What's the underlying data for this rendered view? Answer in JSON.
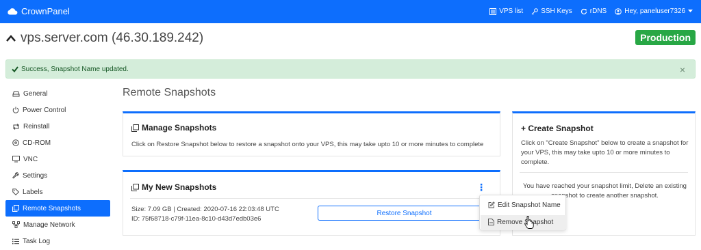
{
  "brand": {
    "name": "CrownPanel",
    "icon": "cloud-icon"
  },
  "topnav": {
    "vps_list": "VPS list",
    "ssh_keys": "SSH Keys",
    "rdns": "rDNS",
    "user": "Hey, paneluser7326"
  },
  "server": {
    "title": "vps.server.com (46.30.189.242)",
    "environment": "Production"
  },
  "alert": {
    "message": "Success, Snapshot Name updated.",
    "close": "×"
  },
  "sidebar": {
    "items": [
      {
        "label": "General",
        "icon": "hdd-icon",
        "active": false
      },
      {
        "label": "Power Control",
        "icon": "power-icon",
        "active": false
      },
      {
        "label": "Reinstall",
        "icon": "retweet-icon",
        "active": false
      },
      {
        "label": "CD-ROM",
        "icon": "disc-icon",
        "active": false
      },
      {
        "label": "VNC",
        "icon": "monitor-icon",
        "active": false
      },
      {
        "label": "Settings",
        "icon": "wrench-icon",
        "active": false
      },
      {
        "label": "Labels",
        "icon": "tag-icon",
        "active": false
      },
      {
        "label": "Remote Snapshots",
        "icon": "copy-icon",
        "active": true
      },
      {
        "label": "Manage Network",
        "icon": "network-icon",
        "active": false
      },
      {
        "label": "Task Log",
        "icon": "list-icon",
        "active": false
      }
    ]
  },
  "main": {
    "section_title": "Remote Snapshots",
    "manage": {
      "title": "Manage Snapshots",
      "text": "Click on Restore Snapshot below to restore a snapshot onto your VPS, this may take upto 10 or more minutes to complete"
    },
    "my_snapshots": {
      "title": "My New Snapshots",
      "snapshot": {
        "meta": "Size: 7.09 GB | Created: 2020-07-16 22:03:48 UTC",
        "id": "ID: 75f68718-c79f-11ea-8c10-d43d7edb03e6",
        "restore_label": "Restore Snapshot"
      }
    },
    "create": {
      "title": "+ Create Snapshot",
      "text": "Click on \"Create Snapshot\" below to create a snapshot for your VPS, this may take upto 10 or more minutes to complete.",
      "limit_text": "You have reached your snapshot limit, Delete an existing snapshot to create another snapshot."
    }
  },
  "dropdown": {
    "edit": "Edit Snapshot Name",
    "remove": "Remove Snapshot"
  },
  "colors": {
    "primary": "#0d6efd",
    "success": "#28a745",
    "alert_bg": "#d4edda"
  }
}
